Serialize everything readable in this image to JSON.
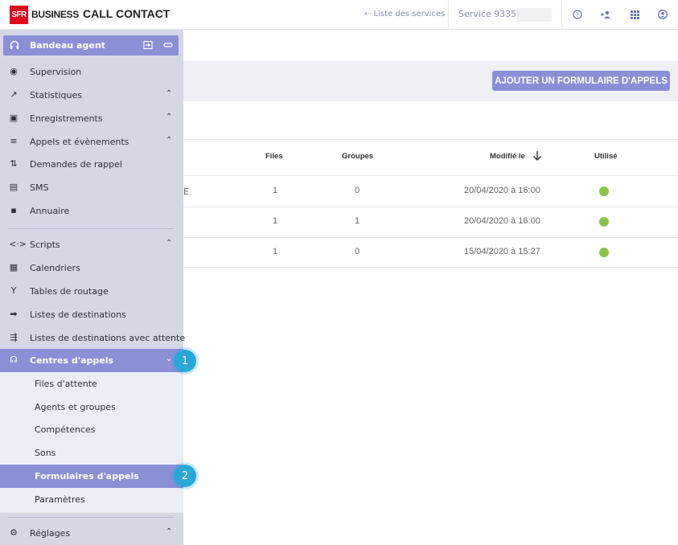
{
  "header": {
    "logo_sfr": "SFR",
    "logo_business": "BUSINESS",
    "app_title": "CALL CONTACT",
    "services_link": "⇠ Liste des services",
    "service_label": "Service 9335",
    "icons": [
      "help-circle-icon",
      "add-user-icon",
      "apps-grid-icon",
      "account-icon"
    ]
  },
  "sidebar": {
    "agent_banner": "Bandeau agent",
    "items": [
      {
        "label": "Supervision",
        "icon": "eye-icon",
        "glyph": "◉",
        "caret": ""
      },
      {
        "label": "Statistiques",
        "icon": "trend-icon",
        "glyph": "↗",
        "caret": "⌃"
      },
      {
        "label": "Enregistrements",
        "icon": "save-icon",
        "glyph": "▣",
        "caret": "⌃"
      },
      {
        "label": "Appels et évènements",
        "icon": "playlist-icon",
        "glyph": "≡",
        "caret": "⌃"
      },
      {
        "label": "Demandes de rappel",
        "icon": "swap-icon",
        "glyph": "⇅",
        "caret": ""
      },
      {
        "label": "SMS",
        "icon": "message-icon",
        "glyph": "▤",
        "caret": ""
      },
      {
        "label": "Annuaire",
        "icon": "contacts-icon",
        "glyph": "▪",
        "caret": ""
      },
      {
        "label": "Scripts",
        "icon": "code-icon",
        "glyph": "<·>",
        "caret": "⌃"
      },
      {
        "label": "Calendriers",
        "icon": "calendar-icon",
        "glyph": "▦",
        "caret": ""
      },
      {
        "label": "Tables de routage",
        "icon": "routing-icon",
        "glyph": "Y",
        "caret": ""
      },
      {
        "label": "Listes de destinations",
        "icon": "arrow-right-icon",
        "glyph": "➡",
        "caret": ""
      },
      {
        "label": "Listes de destinations avec attente",
        "icon": "queue-arrow-icon",
        "glyph": "⇶",
        "caret": ""
      },
      {
        "label": "Centres d'appels",
        "icon": "headset-icon",
        "glyph": "☊",
        "caret": "⌄"
      },
      {
        "label": "Réglages",
        "icon": "settings-icon",
        "glyph": "⚙",
        "caret": "⌃"
      }
    ],
    "submenu": [
      {
        "label": "Files d'attente"
      },
      {
        "label": "Agents et groupes"
      },
      {
        "label": "Compétences"
      },
      {
        "label": "Sons"
      },
      {
        "label": "Formulaires d'appels"
      },
      {
        "label": "Paramètres"
      }
    ]
  },
  "main": {
    "add_button": "AJOUTER UN FORMULAIRE D'APPELS",
    "stray_text": "E",
    "columns": {
      "files": "Files",
      "groupes": "Groupes",
      "modifie": "Modifié le",
      "utilise": "Utilisé"
    },
    "rows": [
      {
        "files": "1",
        "groupes": "0",
        "modifie": "20/04/2020 à 16:00"
      },
      {
        "files": "1",
        "groupes": "1",
        "modifie": "20/04/2020 à 16:00"
      },
      {
        "files": "1",
        "groupes": "0",
        "modifie": "15/04/2020 à 15:27"
      }
    ]
  },
  "steps": [
    "1",
    "2"
  ],
  "colors": {
    "accent": "#8a8fd6",
    "sidebar": "#d6d7e5",
    "used": "#8bc34a",
    "step": "#29a8d8",
    "brand": "#e2001a"
  }
}
